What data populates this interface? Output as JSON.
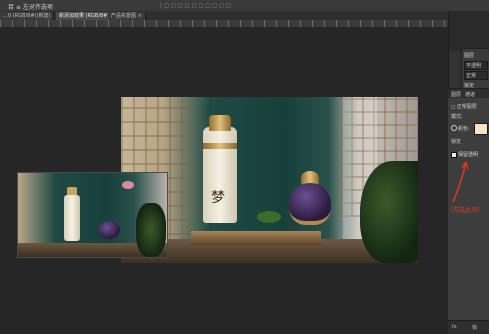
{
  "menubar": {
    "item1": "目 ≡ 左对齐选项"
  },
  "tabs": [
    {
      "label": "…0 (RGB/8#)(新建)"
    },
    {
      "label": "新添加效果 (RGB/8#)×"
    },
    {
      "label": "产品实景图 ×"
    }
  ],
  "panel_a": {
    "title": "图层",
    "row1": "不透明",
    "row2": "正常",
    "row3": "锁定"
  },
  "panel_b": {
    "tab1": "图层",
    "tab2": "通道",
    "row_type": "◻ 正常图层",
    "row_mode": "模式:",
    "row_color": "颜色:",
    "row_lock": "锁定",
    "swatch_color": "#f3e4c9"
  },
  "checkbox": {
    "label": "保留透明",
    "checked": true
  },
  "annotation": {
    "text": "(勾选此项)",
    "color": "#e03a26"
  },
  "document": {
    "glyph": "梦"
  },
  "bottombar": {
    "label1": "fx",
    "label2": "锁"
  }
}
